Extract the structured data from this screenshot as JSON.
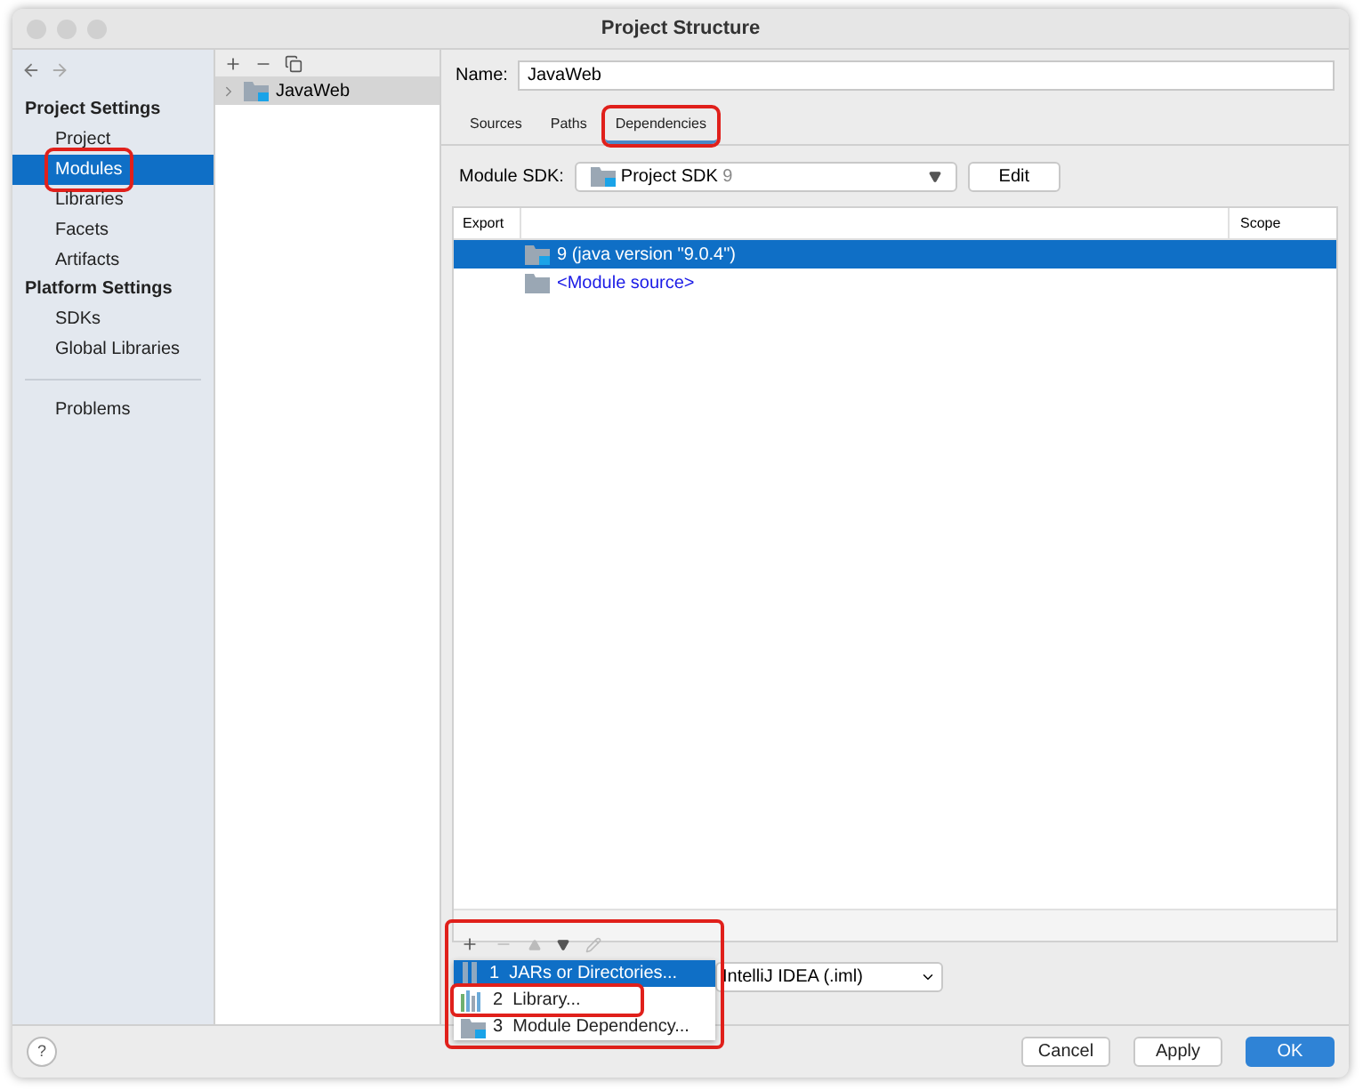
{
  "window": {
    "title": "Project Structure"
  },
  "sidebar": {
    "sections": [
      {
        "heading": "Project Settings",
        "items": [
          {
            "label": "Project",
            "selected": false,
            "highlighted": false
          },
          {
            "label": "Modules",
            "selected": true,
            "highlighted": true
          },
          {
            "label": "Libraries",
            "selected": false,
            "highlighted": false
          },
          {
            "label": "Facets",
            "selected": false,
            "highlighted": false
          },
          {
            "label": "Artifacts",
            "selected": false,
            "highlighted": false
          }
        ]
      },
      {
        "heading": "Platform Settings",
        "items": [
          {
            "label": "SDKs",
            "selected": false,
            "highlighted": false
          },
          {
            "label": "Global Libraries",
            "selected": false,
            "highlighted": false
          }
        ]
      }
    ],
    "bottom_items": [
      {
        "label": "Problems",
        "selected": false,
        "highlighted": false
      }
    ]
  },
  "modules": [
    {
      "label": "JavaWeb",
      "selected": true
    }
  ],
  "name_field": {
    "label": "Name:",
    "value": "JavaWeb"
  },
  "tabs": [
    {
      "label": "Sources",
      "selected": false,
      "highlighted": false
    },
    {
      "label": "Paths",
      "selected": false,
      "highlighted": false
    },
    {
      "label": "Dependencies",
      "selected": true,
      "highlighted": true
    }
  ],
  "module_sdk": {
    "label": "Module SDK:",
    "value": "Project SDK",
    "version": "9",
    "button": "Edit"
  },
  "table": {
    "columns": [
      "Export",
      "",
      "Scope"
    ],
    "rows": [
      {
        "label": "9 (java version \"9.0.4\")",
        "kind": "sdk",
        "selected": true
      },
      {
        "label": "<Module source>",
        "kind": "source",
        "selected": false
      }
    ]
  },
  "add_menu": {
    "highlighted": true,
    "items": [
      {
        "number": "1",
        "label": "JARs or Directories...",
        "kind": "jar",
        "selected": true,
        "highlighted": false
      },
      {
        "number": "2",
        "label": "Library...",
        "kind": "library",
        "selected": false,
        "highlighted": true
      },
      {
        "number": "3",
        "label": "Module Dependency...",
        "kind": "module",
        "selected": false,
        "highlighted": false
      }
    ]
  },
  "storage_format": {
    "value": "IntelliJ IDEA (.iml)"
  },
  "help_button": "?",
  "buttons": [
    {
      "label": "Cancel",
      "kind": "normal"
    },
    {
      "label": "Apply",
      "kind": "normal"
    },
    {
      "label": "OK",
      "kind": "default"
    }
  ]
}
